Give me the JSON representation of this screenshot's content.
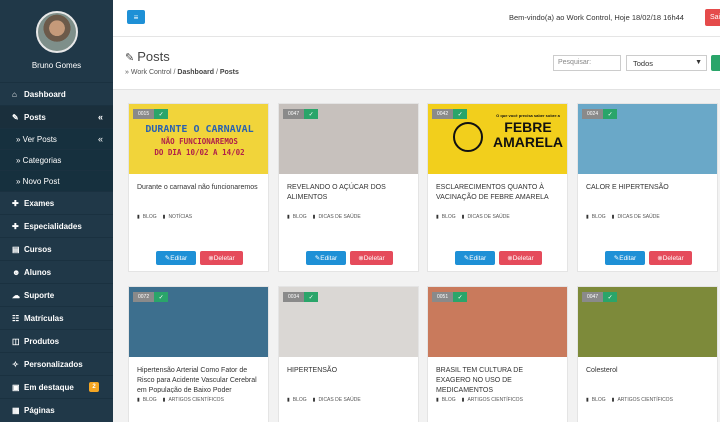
{
  "user": {
    "name": "Bruno Gomes"
  },
  "menu": [
    {
      "label": "Dashboard",
      "icon": "⌂",
      "type": "main"
    },
    {
      "label": "Posts",
      "icon": "✎",
      "type": "main",
      "active": true
    },
    {
      "label": "» Ver Posts",
      "type": "sub"
    },
    {
      "label": "» Categorias",
      "type": "sub"
    },
    {
      "label": "» Novo Post",
      "type": "sub"
    },
    {
      "label": "Exames",
      "icon": "✚",
      "type": "main"
    },
    {
      "label": "Especialidades",
      "icon": "✚",
      "type": "main"
    },
    {
      "label": "Cursos",
      "icon": "▤",
      "type": "main"
    },
    {
      "label": "Alunos",
      "icon": "☻",
      "type": "main"
    },
    {
      "label": "Suporte",
      "icon": "☁",
      "type": "main"
    },
    {
      "label": "Matrículas",
      "icon": "☷",
      "type": "main"
    },
    {
      "label": "Produtos",
      "icon": "◫",
      "type": "main"
    },
    {
      "label": "Personalizados",
      "icon": "✧",
      "type": "main"
    },
    {
      "label": "Em destaque",
      "icon": "▣",
      "type": "main",
      "badge": "2"
    },
    {
      "label": "Páginas",
      "icon": "▦",
      "type": "main"
    }
  ],
  "topbar": {
    "welcome": "Bem-vindo(a) ao Work Control, Hoje 18/02/18 16h44",
    "logout": "Sair"
  },
  "page": {
    "title": "Posts",
    "crumb_root": "» Work Control",
    "crumb_sep": "/",
    "crumb_dashboard": "Dashboard",
    "crumb_current": "Posts",
    "search_placeholder": "Pesquisar:",
    "filter_value": "Todos"
  },
  "labels": {
    "edit": "Editar",
    "delete": "Deletar"
  },
  "posts": [
    {
      "id": "0015",
      "title": "Durante o carnaval não funcionaremos",
      "cats": [
        "BLOG",
        "NOTÍCIAS"
      ],
      "bg": "#f1d43a",
      "img_lines": [
        "DURANTE O CARNAVAL",
        "NÃO FUNCIONAREMOS",
        "DO DIA 10/02 A 14/02"
      ]
    },
    {
      "id": "0047",
      "title": "REVELANDO O AÇÚCAR DOS ALIMENTOS",
      "cats": [
        "BLOG",
        "DICAS DE SAÚDE"
      ],
      "bg": "#c7c1bd",
      "img_lines": []
    },
    {
      "id": "0042",
      "title": "ESCLARECIMENTOS QUANTO À VACINAÇÃO DE FEBRE AMARELA",
      "cats": [
        "BLOG",
        "DICAS DE SAÚDE"
      ],
      "bg": "#f2cf1c",
      "img_lines": [
        "O que você precisa saber sobre a",
        "FEBRE",
        "AMARELA"
      ]
    },
    {
      "id": "0024",
      "title": "CALOR E HIPERTENSÃO",
      "cats": [
        "BLOG",
        "DICAS DE SAÚDE"
      ],
      "bg": "#6aa8c8",
      "img_lines": []
    },
    {
      "id": "0072",
      "title": "Hipertensão Arterial Como Fator de Risco para Acidente Vascular Cerebral em População de Baixo Poder Econômico",
      "cats": [
        "BLOG",
        "ARTIGOS CIENTÍFICOS"
      ],
      "bg": "#3d6f8e",
      "img_lines": []
    },
    {
      "id": "0034",
      "title": "HIPERTENSÃO",
      "cats": [
        "BLOG",
        "DICAS DE SAÚDE"
      ],
      "bg": "#dad7d4",
      "img_lines": []
    },
    {
      "id": "0051",
      "title": "BRASIL TEM CULTURA DE EXAGERO NO USO DE MEDICAMENTOS",
      "cats": [
        "BLOG",
        "ARTIGOS CIENTÍFICOS"
      ],
      "bg": "#c97a5c",
      "img_lines": []
    },
    {
      "id": "0047",
      "title": "Colesterol",
      "cats": [
        "BLOG",
        "ARTIGOS CIENTÍFICOS"
      ],
      "bg": "#7d8a3a",
      "img_lines": []
    }
  ]
}
